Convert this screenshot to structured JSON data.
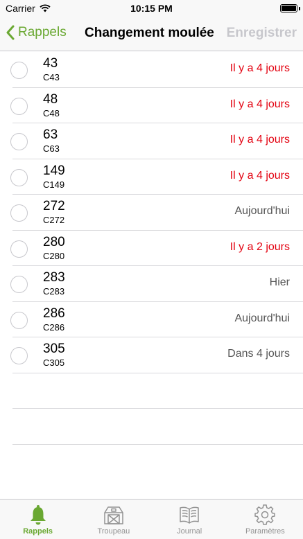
{
  "status_bar": {
    "carrier": "Carrier",
    "time": "10:15 PM"
  },
  "nav": {
    "back_label": "Rappels",
    "title": "Changement moulée",
    "save_label": "Enregistrer"
  },
  "rows": [
    {
      "title": "43",
      "subtitle": "C43",
      "status": "Il y a 4 jours",
      "overdue": true
    },
    {
      "title": "48",
      "subtitle": "C48",
      "status": "Il y a 4 jours",
      "overdue": true
    },
    {
      "title": "63",
      "subtitle": "C63",
      "status": "Il y a 4 jours",
      "overdue": true
    },
    {
      "title": "149",
      "subtitle": "C149",
      "status": "Il y a 4 jours",
      "overdue": true
    },
    {
      "title": "272",
      "subtitle": "C272",
      "status": "Aujourd'hui",
      "overdue": false
    },
    {
      "title": "280",
      "subtitle": "C280",
      "status": "Il y a 2 jours",
      "overdue": true
    },
    {
      "title": "283",
      "subtitle": "C283",
      "status": "Hier",
      "overdue": false
    },
    {
      "title": "286",
      "subtitle": "C286",
      "status": "Aujourd'hui",
      "overdue": false
    },
    {
      "title": "305",
      "subtitle": "C305",
      "status": "Dans 4 jours",
      "overdue": false
    }
  ],
  "tabs": [
    {
      "label": "Rappels",
      "icon": "bell-icon",
      "active": true
    },
    {
      "label": "Troupeau",
      "icon": "barn-icon",
      "active": false
    },
    {
      "label": "Journal",
      "icon": "book-icon",
      "active": false
    },
    {
      "label": "Paramètres",
      "icon": "gear-icon",
      "active": false
    }
  ],
  "colors": {
    "accent": "#6aa832",
    "overdue": "#e3000f",
    "disabled": "#c7c7cc"
  }
}
